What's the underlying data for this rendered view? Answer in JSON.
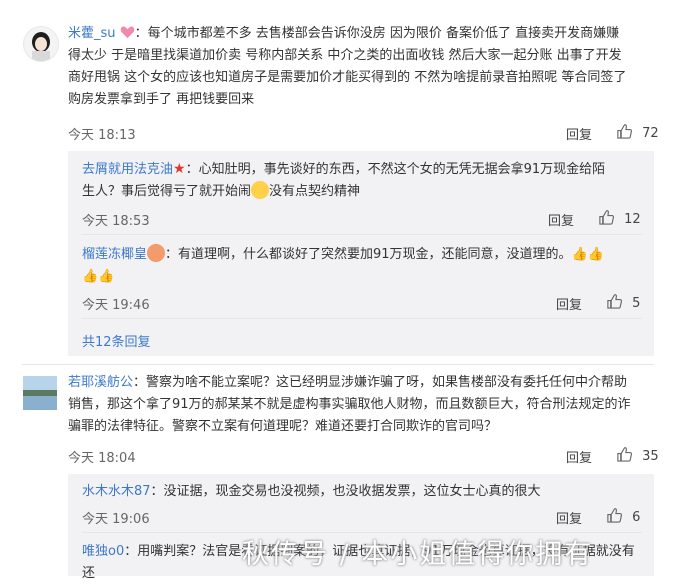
{
  "comment1": {
    "username": "米藿_su",
    "text_l1": "：每个城市都差不多  去售楼部会告诉你没房  因为限价  备案价低了  直接卖开发商嫌赚",
    "text_l2": "得太少  于是暗里找渠道加价卖  号称内部关系  中介之类的出面收钱  然后大家一起分账  出事了开发",
    "text_l3": "商好甩锅  这个女的应该也知道房子是需要加价才能买得到的  不然为啥提前录音拍照呢  等合同签了",
    "text_l4": "购房发票拿到手了  再把钱要回来",
    "time": "今天 18:13",
    "reply_label": "回复",
    "likes": "72",
    "replies": [
      {
        "username": "去屑就用法克油",
        "text_l1": "：心知肚明，事先谈好的东西，不然这个女的无凭无据会拿91万现金给陌",
        "text_l2a": "生人？事后觉得亏了就开始闹",
        "text_l2b": "没有点契约精神",
        "time": "今天 18:53",
        "reply_label": "回复",
        "likes": "12"
      },
      {
        "username": "榴莲冻椰皇",
        "text_l1": "：有道理啊，什么都谈好了突然要加91万现金，还能同意，没道理的。",
        "time": "今天 19:46",
        "reply_label": "回复",
        "likes": "5"
      }
    ],
    "more_replies": "共12条回复"
  },
  "comment2": {
    "username": "若耶溪舫公",
    "text_l1": "：警察为啥不能立案呢？这已经明显涉嫌诈骗了呀，如果售楼部没有委托任何中介帮助",
    "text_l2": "销售，那这个拿了91万的郝某某不就是虚构事实骗取他人财物，而且数额巨大，符合刑法规定的诈",
    "text_l3": "骗罪的法律特征。警察不立案有何道理呢？难道还要打合同欺诈的官司吗？",
    "time": "今天 18:04",
    "reply_label": "回复",
    "likes": "35",
    "replies": [
      {
        "username": "水木水木87",
        "text_l1": "：没证据，现金交易也没视频，也没收据发票，这位女士心真的很大",
        "time": "今天 19:06",
        "reply_label": "回复",
        "likes": "6"
      },
      {
        "username": "唯独o0",
        "text_l1": "：用嘴判案？法官是看证据判案的，证据也算证据，91万现金也算证据，没有证据就没有",
        "text_l2": "还"
      }
    ]
  },
  "watermark": "秋传号 / 本小姐值得你拥有",
  "colors": {
    "username_orange": "#eb7350",
    "username_blue": "#3c79c9",
    "reply_bg": "#f2f2f5"
  }
}
